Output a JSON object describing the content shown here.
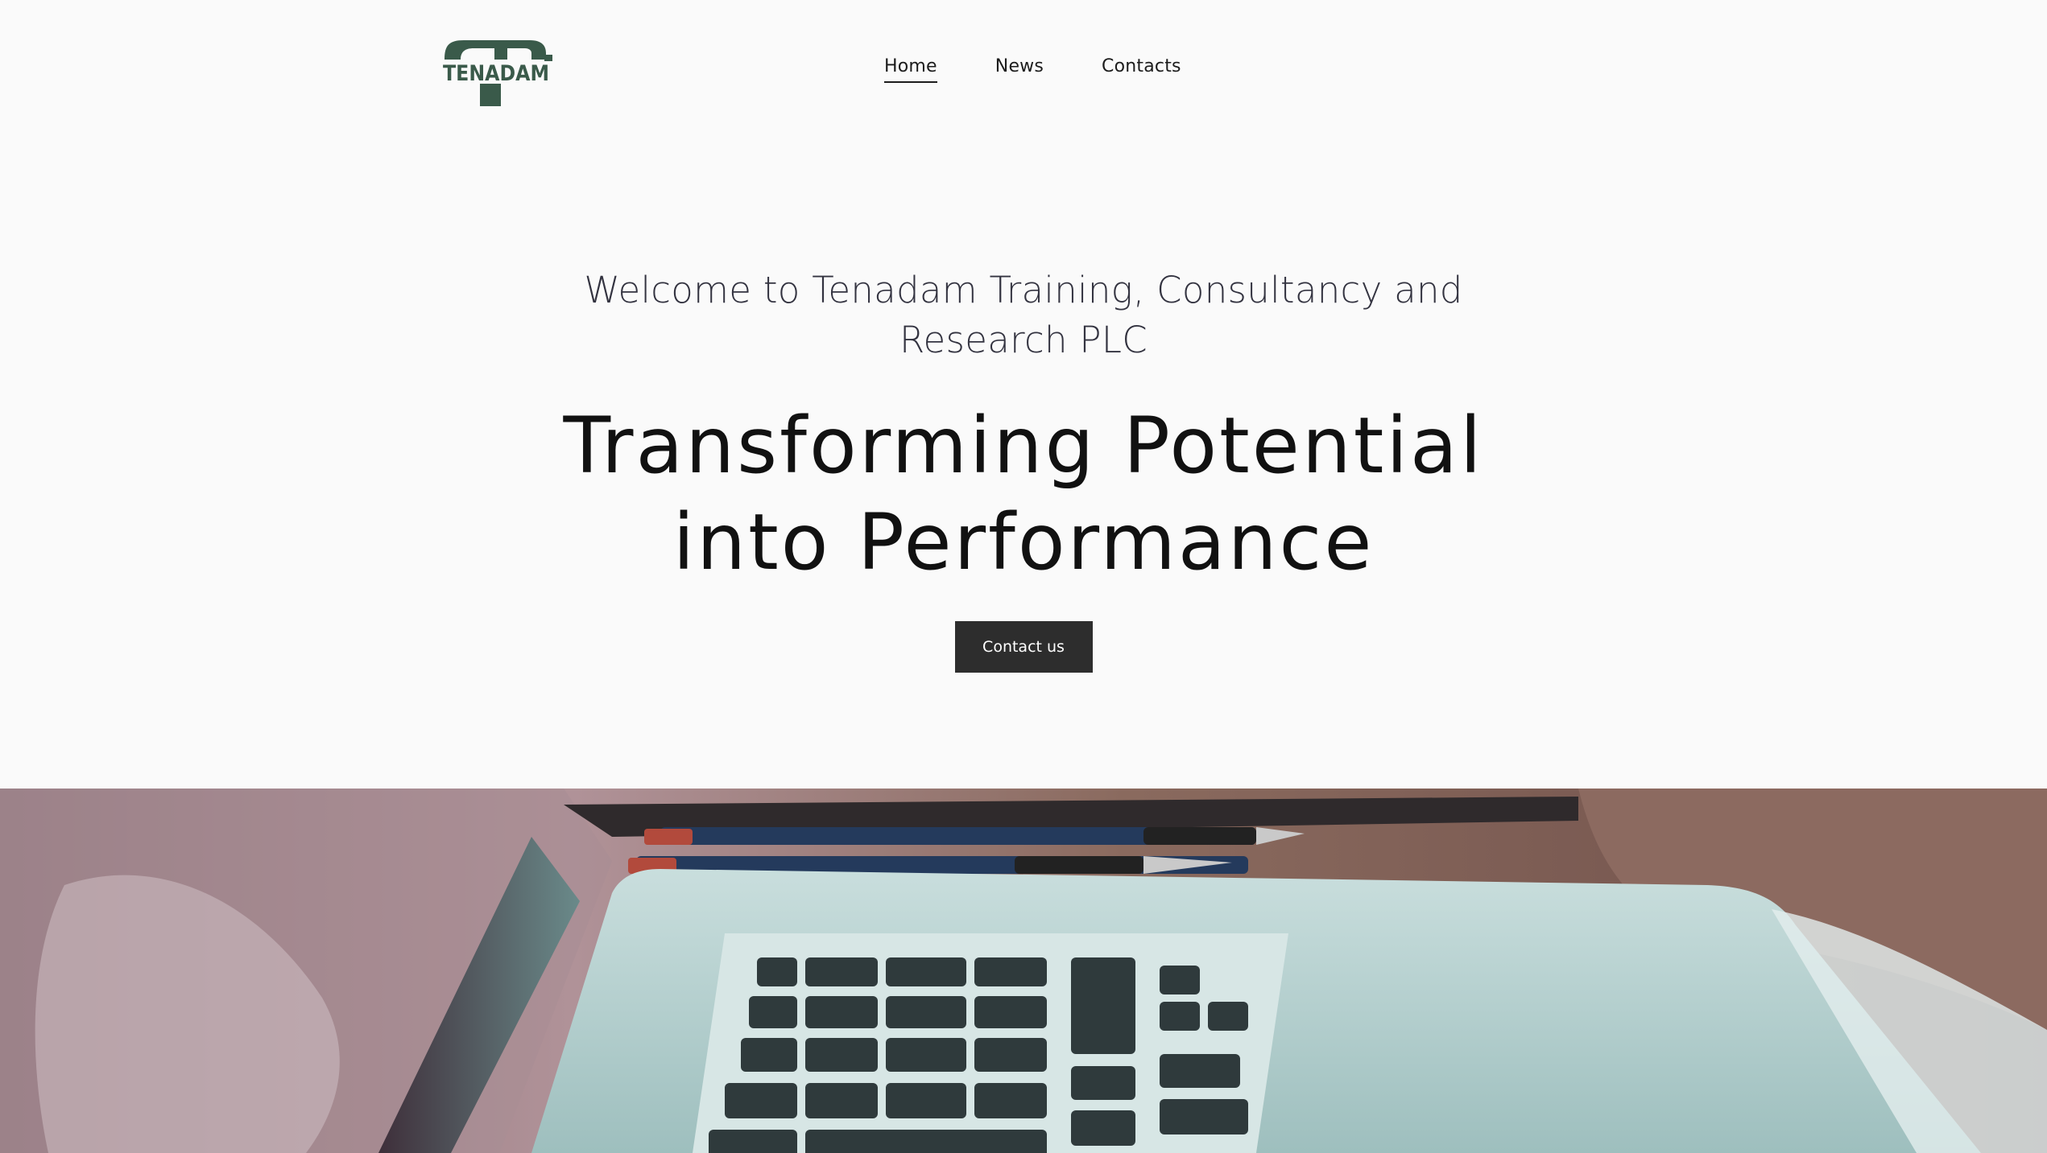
{
  "logo": {
    "text": "TENADAM",
    "color": "#3a5a4a",
    "icon": "tenadam-logo-icon"
  },
  "nav": {
    "items": [
      {
        "label": "Home",
        "active": true
      },
      {
        "label": "News",
        "active": false
      },
      {
        "label": "Contacts",
        "active": false
      }
    ]
  },
  "hero": {
    "welcome": "Welcome to Tenadam Training, Consultancy and Research PLC",
    "headline": "Transforming Potential into Performance",
    "cta_label": "Contact us"
  },
  "photo": {
    "subject": "laptop-keyboard-and-pens-image"
  },
  "colors": {
    "background": "#fafafa",
    "button": "#2d2d2d",
    "logo": "#3a5a4a",
    "text": "#111111"
  }
}
